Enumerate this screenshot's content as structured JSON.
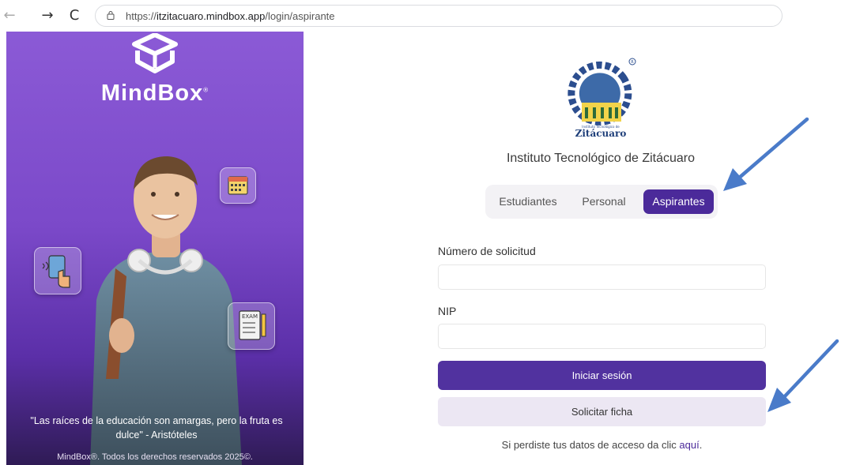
{
  "browser": {
    "back_glyph": "←",
    "forward_glyph": "→",
    "reload_glyph": "C",
    "url_prefix": "https://",
    "url_host": "itzitacuaro.mindbox.app",
    "url_path": "/login/aspirante"
  },
  "brand": {
    "name": "MindBox",
    "mark": "®",
    "quote": "\"Las raíces de la educación son amargas, pero la fruta es dulce\" - Aristóteles",
    "copyright": "MindBox®. Todos los derechos reservados 2025©.",
    "accent": "#7b49c9"
  },
  "institution": {
    "logo_text": "Zitácuaro",
    "logo_small_text": "Instituto Tecnológico de",
    "name": "Instituto Tecnológico de Zitácuaro"
  },
  "tabs": [
    {
      "label": "Estudiantes",
      "active": false
    },
    {
      "label": "Personal",
      "active": false
    },
    {
      "label": "Aspirantes",
      "active": true
    }
  ],
  "form": {
    "solicitud_label": "Número de solicitud",
    "solicitud_value": "",
    "nip_label": "NIP",
    "nip_value": "",
    "login_button": "Iniciar sesión",
    "request_button": "Solicitar ficha",
    "recover_text": "Si perdiste tus datos de acceso da clic",
    "recover_link": "aquí",
    "recover_end": "."
  },
  "colors": {
    "primary": "#51329f",
    "secondary": "#ece7f3",
    "annotation_arrow": "#4a7bc9"
  }
}
